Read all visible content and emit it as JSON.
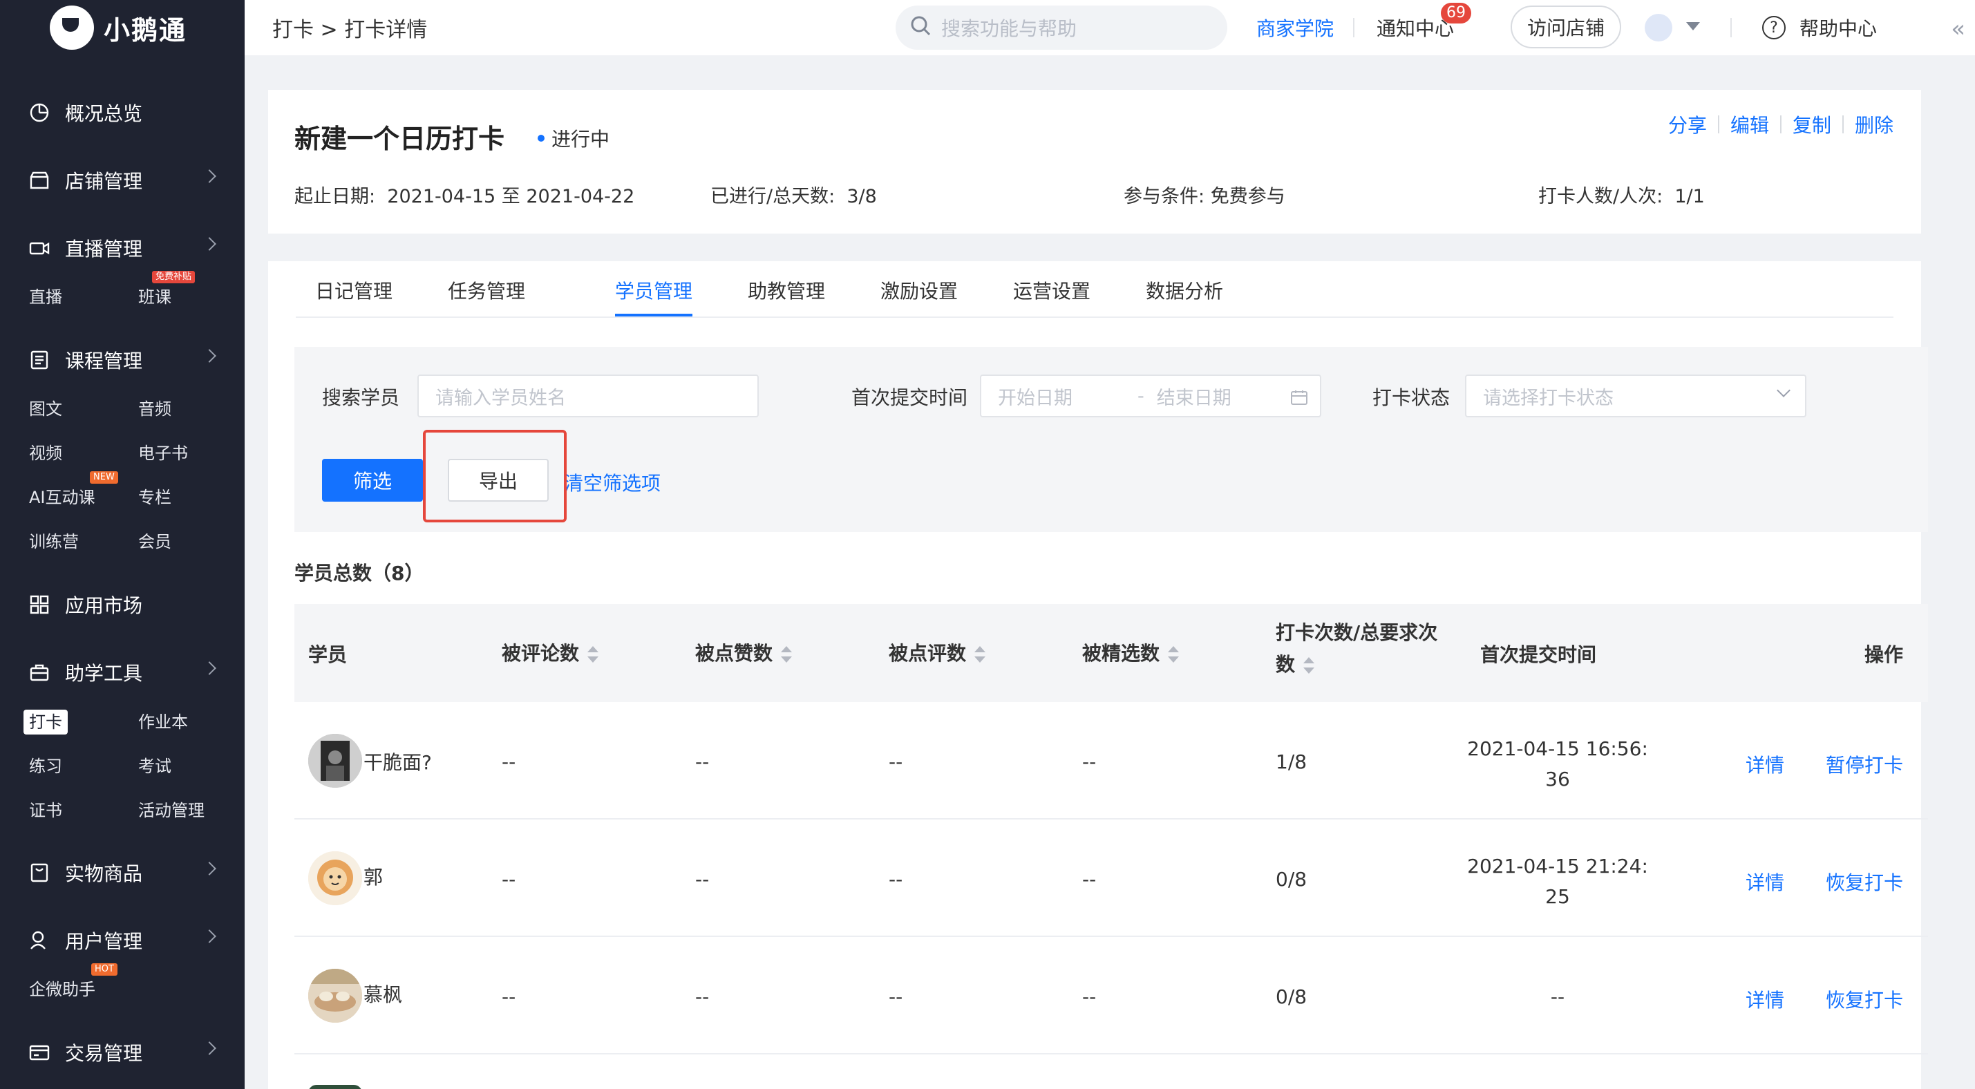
{
  "sidebar": {
    "logo_text": "小鹅通",
    "items": [
      {
        "label": "概况总览",
        "icon": "dashboard-icon"
      },
      {
        "label": "店铺管理",
        "icon": "store-icon"
      },
      {
        "label": "直播管理",
        "icon": "live-camera-icon"
      },
      {
        "label": "课程管理",
        "icon": "course-icon"
      },
      {
        "label": "应用市场",
        "icon": "app-grid-icon"
      },
      {
        "label": "助学工具",
        "icon": "toolbox-icon"
      },
      {
        "label": "实物商品",
        "icon": "bag-icon"
      },
      {
        "label": "用户管理",
        "icon": "user-icon"
      },
      {
        "label": "交易管理",
        "icon": "card-icon"
      }
    ],
    "sub": {
      "live": "直播",
      "class": "班课",
      "class_tag": "免费补贴",
      "text": "图文",
      "audio": "音频",
      "video": "视频",
      "ebook": "电子书",
      "ai": "AI互动课",
      "ai_tag": "NEW",
      "column": "专栏",
      "camp": "训练营",
      "member": "会员",
      "checkin": "打卡",
      "homework": "作业本",
      "practice": "练习",
      "exam": "考试",
      "cert": "证书",
      "activity": "活动管理",
      "wecom": "企微助手",
      "wecom_tag": "HOT"
    }
  },
  "topbar": {
    "breadcrumb": "打卡 > 打卡详情",
    "search_placeholder": "搜索功能与帮助",
    "academy": "商家学院",
    "notice": "通知中心",
    "notice_count": "69",
    "visit_store": "访问店铺",
    "help": "帮助中心"
  },
  "detail": {
    "title": "新建一个日历打卡",
    "status": "进行中",
    "actions": [
      "分享",
      "编辑",
      "复制",
      "删除"
    ],
    "date_label": "起止日期:",
    "date_value": "2021-04-15 至 2021-04-22",
    "progress_label": "已进行/总天数:",
    "progress_value": "3/8",
    "condition_label": "参与条件:",
    "condition_value": "免费参与",
    "count_label": "打卡人数/人次:",
    "count_value": "1/1"
  },
  "tabs": [
    "日记管理",
    "任务管理",
    "学员管理",
    "助教管理",
    "激励设置",
    "运营设置",
    "数据分析"
  ],
  "filter": {
    "search_label": "搜索学员",
    "search_placeholder": "请输入学员姓名",
    "date_label": "首次提交时间",
    "start_placeholder": "开始日期",
    "date_sep": "-",
    "end_placeholder": "结束日期",
    "status_label": "打卡状态",
    "status_placeholder": "请选择打卡状态",
    "filter_btn": "筛选",
    "export_btn": "导出",
    "clear_link": "清空筛选项"
  },
  "table": {
    "total": "学员总数（8）",
    "headers": {
      "student": "学员",
      "comments": "被评论数",
      "likes": "被点赞数",
      "reviews": "被点评数",
      "featured": "被精选数",
      "checkins_1": "打卡次数/总要求次",
      "checkins_2": "数",
      "first_time": "首次提交时间",
      "ops": "操作"
    },
    "rows": [
      {
        "name": "干脆面?",
        "comments": "--",
        "likes": "--",
        "reviews": "--",
        "featured": "--",
        "checkins": "1/8",
        "time_1": "2021-04-15 16:56:",
        "time_2": "36",
        "detail": "详情",
        "action": "暂停打卡"
      },
      {
        "name": "郭",
        "comments": "--",
        "likes": "--",
        "reviews": "--",
        "featured": "--",
        "checkins": "0/8",
        "time_1": "2021-04-15 21:24:",
        "time_2": "25",
        "detail": "详情",
        "action": "恢复打卡"
      },
      {
        "name": "慕枫",
        "comments": "--",
        "likes": "--",
        "reviews": "--",
        "featured": "--",
        "checkins": "0/8",
        "time_1": "--",
        "time_2": "",
        "detail": "详情",
        "action": "恢复打卡"
      }
    ]
  },
  "colors": {
    "sidebar": "#1f2331",
    "accent": "#1472ff",
    "highlight": "#e5473c"
  }
}
